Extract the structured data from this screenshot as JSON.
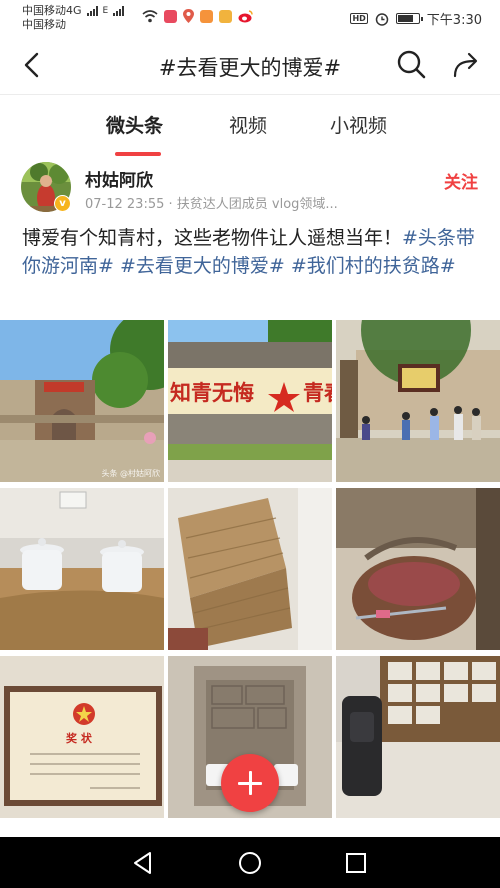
{
  "status_bar": {
    "carrier_1": "中国移动4G",
    "carrier_2": "中国移动",
    "network": "4G",
    "signal_label": "E",
    "hd": "HD",
    "time": "下午3:30",
    "battery_level": 0.8
  },
  "nav": {
    "title": "#去看更大的博爱#"
  },
  "tabs": [
    {
      "label": "微头条",
      "active": true
    },
    {
      "label": "视频",
      "active": false
    },
    {
      "label": "小视频",
      "active": false
    }
  ],
  "author": {
    "name": "村姑阿欣",
    "verified_badge": "v",
    "meta": "07-12 23:55 · 扶贫达人团成员 vlog领域...",
    "follow_label": "关注"
  },
  "post": {
    "text": "博爱有个知青村，这些老物件让人遥想当年！",
    "tags": [
      "#头条带你游河南#",
      "#去看更大的博爱#",
      "#我们村的扶贫路#"
    ]
  },
  "images": {
    "banner_text": "知青无悔",
    "banner_text_2": "青春",
    "certificate_title": "奖  状",
    "watermark": "头条 @村姑阿欣"
  },
  "colors": {
    "accent": "#f04142",
    "tag": "#406599",
    "meta": "#999999"
  },
  "icons": {
    "back": "chevron-left",
    "search": "magnifier",
    "share": "curved-arrow",
    "compose": "plus"
  }
}
